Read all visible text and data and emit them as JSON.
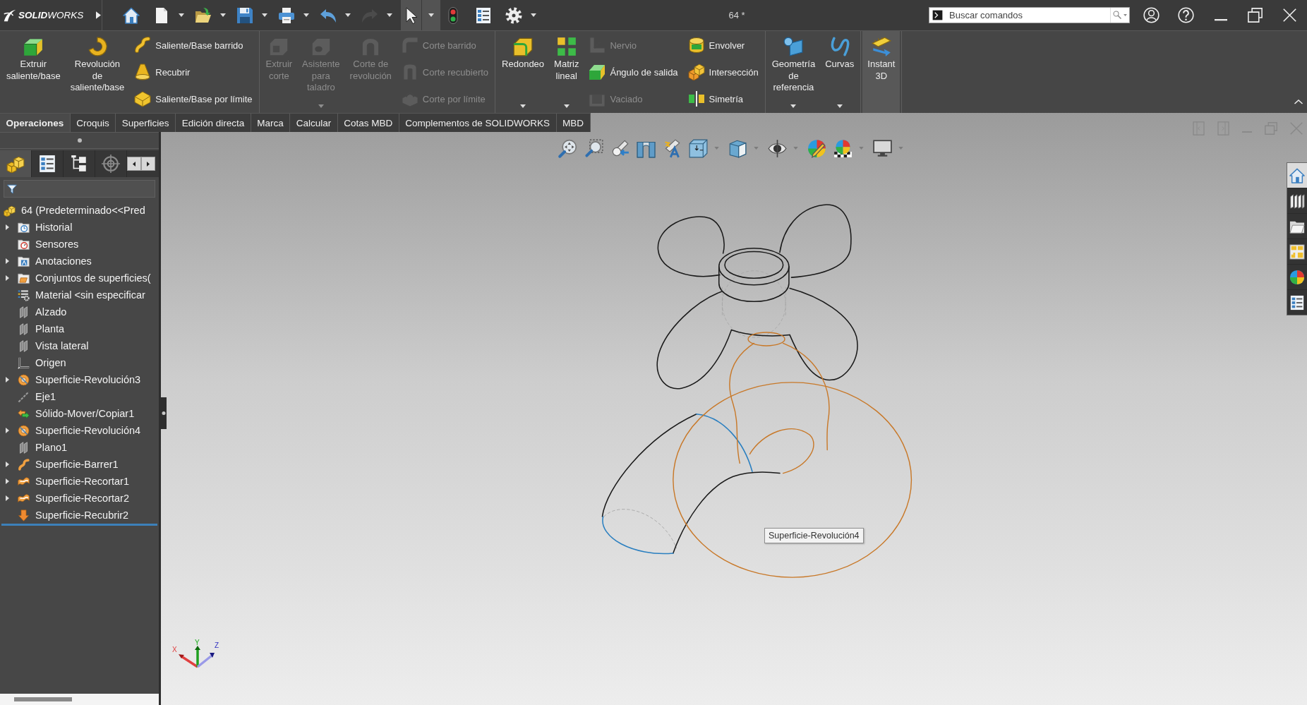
{
  "title_bar": {
    "logo": "**SOLID**WORKS",
    "quick_access": [
      {
        "kind": "home",
        "dropdown": false,
        "disabled": false,
        "selected": false
      },
      {
        "kind": "new",
        "dropdown": true,
        "disabled": false,
        "selected": false
      },
      {
        "kind": "open",
        "dropdown": true,
        "disabled": false,
        "selected": false
      },
      {
        "kind": "save",
        "dropdown": true,
        "disabled": false,
        "selected": false
      },
      {
        "kind": "print",
        "dropdown": true,
        "disabled": false,
        "selected": false
      },
      {
        "kind": "undo",
        "dropdown": true,
        "disabled": false,
        "selected": false
      },
      {
        "kind": "redo",
        "dropdown": true,
        "disabled": true,
        "selected": false
      },
      {
        "kind": "select",
        "dropdown": true,
        "disabled": false,
        "selected": true
      },
      {
        "kind": "rebuild",
        "dropdown": false,
        "disabled": false,
        "selected": false
      },
      {
        "kind": "file-properties",
        "dropdown": false,
        "disabled": false,
        "selected": false
      },
      {
        "kind": "options",
        "dropdown": true,
        "disabled": false,
        "selected": false
      }
    ],
    "document_title": "64 *",
    "search": {
      "placeholder": "Buscar comandos"
    }
  },
  "ribbon": {
    "groups": [
      {
        "large": [
          {
            "kind": "extrude",
            "label": "Extruir saliente/base",
            "disabled": false,
            "dropdown": false,
            "on": false
          },
          {
            "kind": "revolve",
            "label": "Revolución de saliente/base",
            "disabled": false,
            "dropdown": false,
            "on": false
          }
        ],
        "columns": [
          [
            {
              "kind": "sweep",
              "label": "Saliente/Base barrido",
              "disabled": false
            },
            {
              "kind": "loft",
              "label": "Recubrir",
              "disabled": false
            },
            {
              "kind": "boundary",
              "label": "Saliente/Base por límite",
              "disabled": false
            }
          ]
        ]
      },
      {
        "large": [
          {
            "kind": "extrude-cut",
            "label": "Extruir corte",
            "disabled": true,
            "dropdown": false,
            "on": false
          },
          {
            "kind": "hole",
            "label": "Asistente para taladro",
            "disabled": true,
            "dropdown": true,
            "on": false
          },
          {
            "kind": "revolve-cut",
            "label": "Corte de revolución",
            "disabled": true,
            "dropdown": false,
            "on": false
          }
        ],
        "columns": [
          [
            {
              "kind": "sweep-cut",
              "label": "Corte barrido",
              "disabled": true
            },
            {
              "kind": "loft-cut",
              "label": "Corte recubierto",
              "disabled": true
            },
            {
              "kind": "boundary-cut",
              "label": "Corte por límite",
              "disabled": true
            }
          ]
        ]
      },
      {
        "large": [
          {
            "kind": "fillet",
            "label": "Redondeo",
            "disabled": false,
            "dropdown": true,
            "on": false
          },
          {
            "kind": "pattern",
            "label": "Matriz lineal",
            "disabled": false,
            "dropdown": true,
            "on": false
          }
        ],
        "columns": [
          [
            {
              "kind": "rib",
              "label": "Nervio",
              "disabled": true
            },
            {
              "kind": "draft",
              "label": "Ángulo de salida",
              "disabled": false
            },
            {
              "kind": "shell",
              "label": "Vaciado",
              "disabled": true
            }
          ],
          [
            {
              "kind": "wrap",
              "label": "Envolver",
              "disabled": false
            },
            {
              "kind": "intersect",
              "label": "Intersección",
              "disabled": false
            },
            {
              "kind": "mirror",
              "label": "Simetría",
              "disabled": false
            }
          ]
        ]
      },
      {
        "large": [
          {
            "kind": "reference-geometry",
            "label": "Geometría de referencia",
            "disabled": false,
            "dropdown": true,
            "on": false
          },
          {
            "kind": "curves",
            "label": "Curvas",
            "disabled": false,
            "dropdown": true,
            "on": false
          }
        ]
      },
      {
        "large": [
          {
            "kind": "instant3d",
            "label": "Instant 3D",
            "disabled": false,
            "dropdown": false,
            "on": true
          }
        ]
      }
    ]
  },
  "tabs": [
    {
      "label": "Operaciones",
      "selected": true
    },
    {
      "label": "Croquis",
      "selected": false
    },
    {
      "label": "Superficies",
      "selected": false
    },
    {
      "label": "Edición directa",
      "selected": false
    },
    {
      "label": "Marca",
      "selected": false
    },
    {
      "label": "Calcular",
      "selected": false
    },
    {
      "label": "Cotas MBD",
      "selected": false
    },
    {
      "label": "Complementos de SOLIDWORKS",
      "selected": false
    },
    {
      "label": "MBD",
      "selected": false
    }
  ],
  "feature_panel": {
    "tabs": [
      {
        "kind": "feature-manager",
        "selected": true
      },
      {
        "kind": "property-manager",
        "selected": false
      },
      {
        "kind": "configuration-manager",
        "selected": false
      },
      {
        "kind": "dimxpert-manager",
        "selected": false
      }
    ],
    "tree": {
      "kind": "part",
      "label": "64 (Predeterminado<<Pred",
      "children": [
        {
          "kind": "history",
          "label": "Historial",
          "expanded": false
        },
        {
          "kind": "sensors",
          "label": "Sensores"
        },
        {
          "kind": "annotations",
          "label": "Anotaciones",
          "expanded": false
        },
        {
          "kind": "surface-bodies",
          "label": "Conjuntos de superficies(",
          "expanded": false
        },
        {
          "kind": "material",
          "label": "Material <sin especificar"
        },
        {
          "kind": "plane",
          "label": "Alzado"
        },
        {
          "kind": "plane",
          "label": "Planta"
        },
        {
          "kind": "plane",
          "label": "Vista lateral"
        },
        {
          "kind": "origin",
          "label": "Origen"
        },
        {
          "kind": "revolve-surface",
          "label": "Superficie-Revolución3",
          "expanded": false
        },
        {
          "kind": "axis",
          "label": "Eje1"
        },
        {
          "kind": "move-copy",
          "label": "Sólido-Mover/Copiar1"
        },
        {
          "kind": "revolve-surface",
          "label": "Superficie-Revolución4",
          "expanded": false
        },
        {
          "kind": "plane",
          "label": "Plano1"
        },
        {
          "kind": "sweep-surface",
          "label": "Superficie-Barrer1",
          "expanded": false
        },
        {
          "kind": "trim-surface",
          "label": "Superficie-Recortar1",
          "expanded": false
        },
        {
          "kind": "trim-surface",
          "label": "Superficie-Recortar2",
          "expanded": false
        },
        {
          "kind": "loft-surface",
          "label": "Superficie-Recubrir2"
        }
      ]
    }
  },
  "graphics_area": {
    "view_toolbar": [
      {
        "kind": "zoom-to-fit",
        "dropdown": false
      },
      {
        "kind": "zoom-to-area",
        "dropdown": false
      },
      {
        "kind": "previous-view",
        "dropdown": false
      },
      {
        "kind": "section-view",
        "dropdown": false
      },
      {
        "kind": "dynamic-annotation",
        "dropdown": false
      },
      {
        "kind": "view-orientation",
        "dropdown": true
      },
      {
        "kind": "display-style",
        "dropdown": true
      },
      {
        "kind": "hide-show",
        "dropdown": true
      },
      {
        "kind": "edit-appearance",
        "dropdown": false
      },
      {
        "kind": "apply-scene",
        "dropdown": true
      },
      {
        "kind": "view-settings",
        "dropdown": true
      }
    ],
    "task_pane": [
      {
        "kind": "home",
        "selected": true
      },
      {
        "kind": "design-library",
        "selected": false
      },
      {
        "kind": "file-explorer",
        "selected": false
      },
      {
        "kind": "view-palette",
        "selected": false
      },
      {
        "kind": "appearances",
        "selected": false
      },
      {
        "kind": "custom-properties",
        "selected": false
      }
    ],
    "tooltip": "Superficie-Revolución4",
    "triad_labels": [
      "X",
      "Y",
      "Z"
    ]
  }
}
